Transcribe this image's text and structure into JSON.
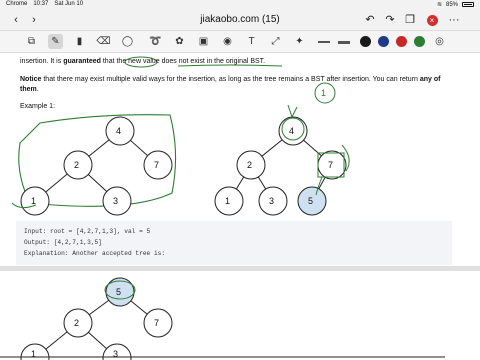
{
  "status": {
    "app": "Chrome",
    "time": "10:37",
    "date": "Sat Jun 10",
    "battery": "85%"
  },
  "nav": {
    "title": "jiakaobo.com (15)",
    "back_icon": "chevron-left-icon",
    "forward_icon": "chevron-right-icon",
    "undo_icon": "undo-icon",
    "redo_icon": "redo-icon",
    "copy_icon": "copy-icon",
    "close_icon": "close-icon",
    "more_icon": "more-icon"
  },
  "toolbar": {
    "colors": [
      "#1a1a1a",
      "#1e3a8a",
      "#c62828",
      "#2e7d32"
    ]
  },
  "content": {
    "line1_prefix": "insertion. It is ",
    "line1_bold": "guaranteed",
    "line1_suffix": " that the new value does not exist in the original BST.",
    "notice_bold": "Notice",
    "notice_text": " that there may exist multiple valid ways for the insertion, as long as the tree remains a BST after insertion. You can return ",
    "notice_any": "any of",
    "notice_them": "them",
    "notice_end": ".",
    "example_title": "Example 1:",
    "input_line": "Input: root = [4,2,7,1,3], val = 5",
    "output_line": "Output: [4,2,7,1,3,5]",
    "explanation_line": "Explanation: Another accepted tree is:"
  },
  "tree1": {
    "nodes": [
      "4",
      "2",
      "7",
      "1",
      "3"
    ]
  },
  "tree2": {
    "nodes": [
      "4",
      "2",
      "7",
      "1",
      "3",
      "5"
    ],
    "annotation": "1"
  },
  "tree3": {
    "nodes": [
      "5",
      "2",
      "7",
      "1",
      "3"
    ]
  }
}
